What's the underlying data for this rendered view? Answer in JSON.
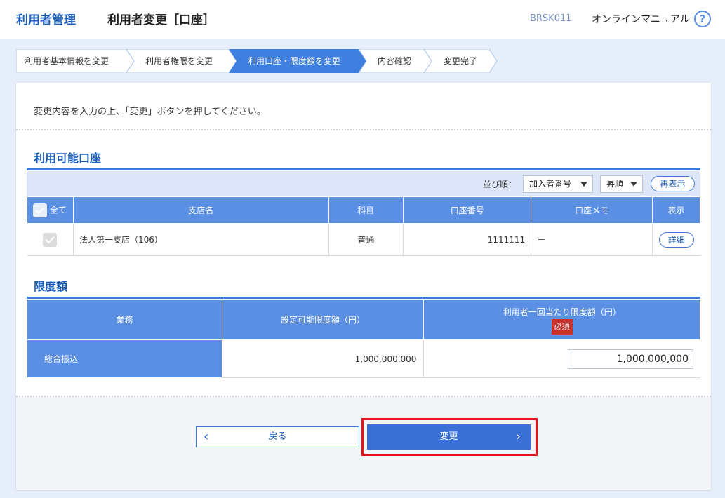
{
  "header": {
    "section": "利用者管理",
    "title": "利用者変更［口座］",
    "screen_code": "BRSK011",
    "manual": "オンラインマニュアル",
    "help_icon": "?"
  },
  "steps": [
    {
      "label": "利用者基本情報を変更",
      "active": false
    },
    {
      "label": "利用者権限を変更",
      "active": false
    },
    {
      "label": "利用口座・限度額を変更",
      "active": true
    },
    {
      "label": "内容確認",
      "active": false
    },
    {
      "label": "変更完了",
      "active": false
    }
  ],
  "instruction": "変更内容を入力の上、「変更」ボタンを押してください。",
  "accounts": {
    "heading": "利用可能口座",
    "sort_label": "並び順：",
    "sort_key": "加入者番号",
    "sort_order": "昇順",
    "refresh": "再表示",
    "columns": {
      "all": "全て",
      "branch": "支店名",
      "type": "科目",
      "number": "口座番号",
      "memo": "口座メモ",
      "view": "表示"
    },
    "rows": [
      {
        "branch": "法人第一支店（106）",
        "type": "普通",
        "number": "1111111",
        "memo": "－",
        "view": "詳細"
      }
    ]
  },
  "limits": {
    "heading": "限度額",
    "columns": {
      "business": "業務",
      "settable": "設定可能限度額（円）",
      "per_user": "利用者一回当たり限度額（円）",
      "required": "必須"
    },
    "rows": [
      {
        "business": "総合振込",
        "settable": "1,000,000,000",
        "value": "1,000,000,000"
      }
    ]
  },
  "buttons": {
    "back": "戻る",
    "change": "変更"
  },
  "colors": {
    "accent": "#3a6fd6",
    "header_blue": "#5b8fe3",
    "highlight": "#e3161e"
  }
}
